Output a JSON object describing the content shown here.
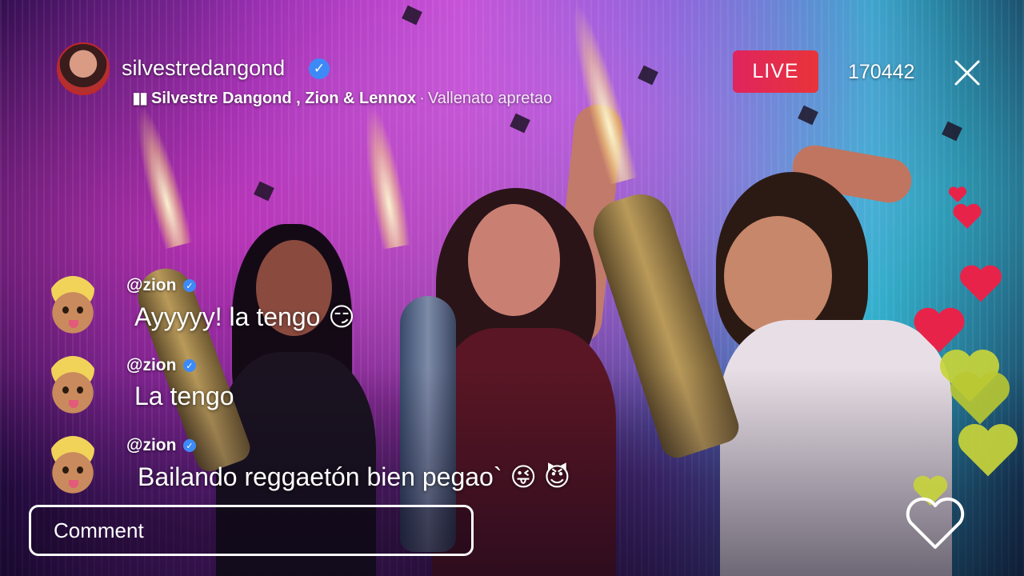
{
  "header": {
    "host_username": "silvestredangond",
    "song": {
      "artist": "Silvestre Dangond , Zion & Lennox",
      "separator": "·",
      "album": "Vallenato apretao"
    },
    "live_label": "LIVE",
    "viewer_count": "170442"
  },
  "comments": [
    {
      "user": "@zion",
      "text": "Ayyyyy! la tengo",
      "emoji": "😏"
    },
    {
      "user": "@zion",
      "text": "La tengo",
      "emoji": ""
    },
    {
      "user": "@zion",
      "text": "Bailando reggaetón bien pegao`",
      "emoji": "😜 😈"
    }
  ],
  "comment_input": {
    "placeholder": "Comment"
  },
  "colors": {
    "live_badge": "#e0245e",
    "verified": "#3d8af7",
    "heart_red": "#e8234a",
    "heart_yellow": "#c8d43a"
  },
  "icons": [
    "verified-badge-icon",
    "equalizer-bars-icon",
    "close-icon",
    "heart-outline-icon",
    "floating-heart-icon"
  ]
}
